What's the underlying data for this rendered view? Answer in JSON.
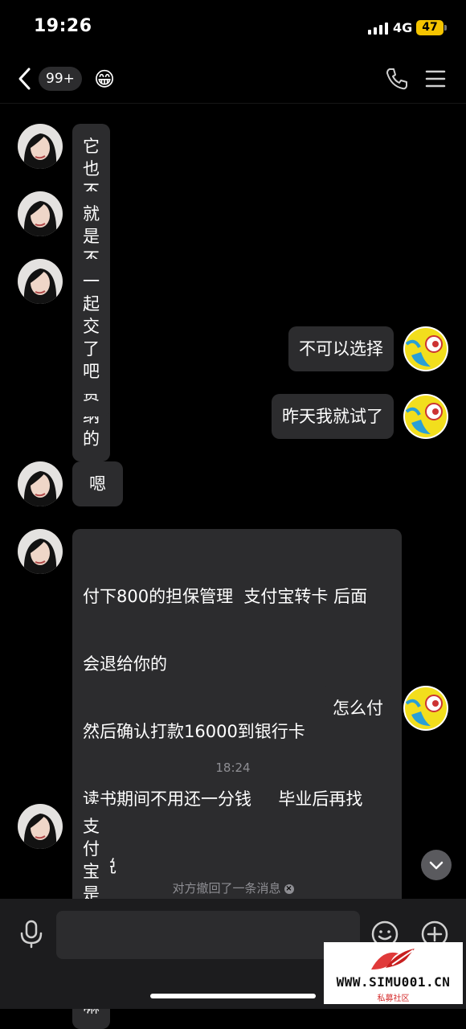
{
  "status_bar": {
    "time": "19:26",
    "network": "4G",
    "battery": "47"
  },
  "header": {
    "unread_badge": "99+",
    "emoji": "😁"
  },
  "messages": [
    {
      "side": "left",
      "text": "它也不可以就当选学费来缴纳的"
    },
    {
      "side": "left",
      "text": "就是不可以选择缴费"
    },
    {
      "side": "left",
      "text": "一起交了吧"
    },
    {
      "side": "right",
      "text": "不可以选择"
    },
    {
      "side": "right",
      "text": "昨天我就试了"
    },
    {
      "side": "left",
      "text": "嗯"
    },
    {
      "side": "left",
      "lines": [
        "付下800的担保管理  支付宝转卡 后面",
        "会退给你的",
        "然后确认打款16000到银行卡",
        "读书期间不用还一分钱     毕业后再找",
        "你说"
      ]
    },
    {
      "side": "right",
      "text": "怎么付"
    },
    {
      "side": "left",
      "text": "支付宝是你实名的嘛"
    }
  ],
  "timestamp": "18:24",
  "recall_notice": "对方撤回了一条消息",
  "watermark": {
    "url": "WWW.SIMU001.CN",
    "subtitle": "私募社区"
  }
}
